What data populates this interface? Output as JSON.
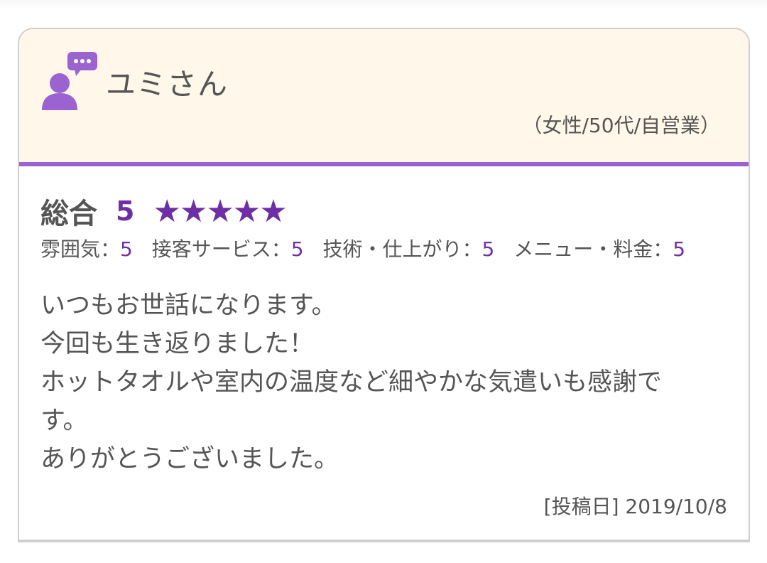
{
  "reviewer": {
    "name": "ユミさん",
    "meta": "（女性/50代/自営業）",
    "icon": "person-chat-icon"
  },
  "rating": {
    "overall_label": "総合",
    "overall_score": "5",
    "stars": "★★★★★",
    "overall_stars_value": 5,
    "sub": [
      {
        "label": "雰囲気：",
        "value": "5"
      },
      {
        "label": "接客サービス：",
        "value": "5"
      },
      {
        "label": "技術・仕上がり：",
        "value": "5"
      },
      {
        "label": "メニュー・料金：",
        "value": "5"
      }
    ]
  },
  "comment": {
    "lines": [
      "いつもお世話になります。",
      "今回も生き返りました！",
      "ホットタオルや室内の温度など細やかな気遣いも感謝で",
      "す。",
      "ありがとうございました。"
    ]
  },
  "post_date": "[投稿日] 2019/10/8",
  "colors": {
    "header_bg": "#fff7e9",
    "accent_purple": "#9a63cf",
    "rating_purple": "#6e2fa6",
    "text_gray": "#555555",
    "border_gray": "#cfcfcf"
  }
}
